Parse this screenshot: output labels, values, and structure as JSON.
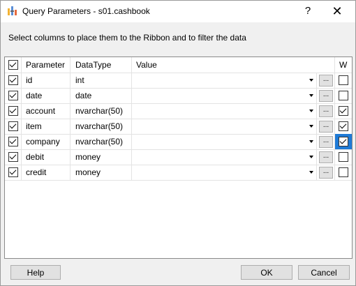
{
  "window": {
    "title": "Query Parameters - s01.cashbook",
    "help_glyph": "?",
    "close_glyph": "✕"
  },
  "instruction": "Select columns to place them to the Ribbon and to filter the data",
  "grid": {
    "headers": {
      "select_all_checked": true,
      "parameter": "Parameter",
      "datatype": "DataType",
      "value": "Value",
      "w": "W"
    },
    "rows": [
      {
        "checked": true,
        "parameter": "id",
        "datatype": "int",
        "value": "",
        "w": false
      },
      {
        "checked": true,
        "parameter": "date",
        "datatype": "date",
        "value": "",
        "w": false
      },
      {
        "checked": true,
        "parameter": "account",
        "datatype": "nvarchar(50)",
        "value": "",
        "w": true
      },
      {
        "checked": true,
        "parameter": "item",
        "datatype": "nvarchar(50)",
        "value": "",
        "w": true
      },
      {
        "checked": true,
        "parameter": "company",
        "datatype": "nvarchar(50)",
        "value": "",
        "w": true,
        "focused": true
      },
      {
        "checked": true,
        "parameter": "debit",
        "datatype": "money",
        "value": "",
        "w": false
      },
      {
        "checked": true,
        "parameter": "credit",
        "datatype": "money",
        "value": "",
        "w": false
      }
    ],
    "ellipsis": "..."
  },
  "buttons": {
    "help": "Help",
    "ok": "OK",
    "cancel": "Cancel"
  },
  "colors": {
    "focus_accent": "#1e7ad6"
  }
}
